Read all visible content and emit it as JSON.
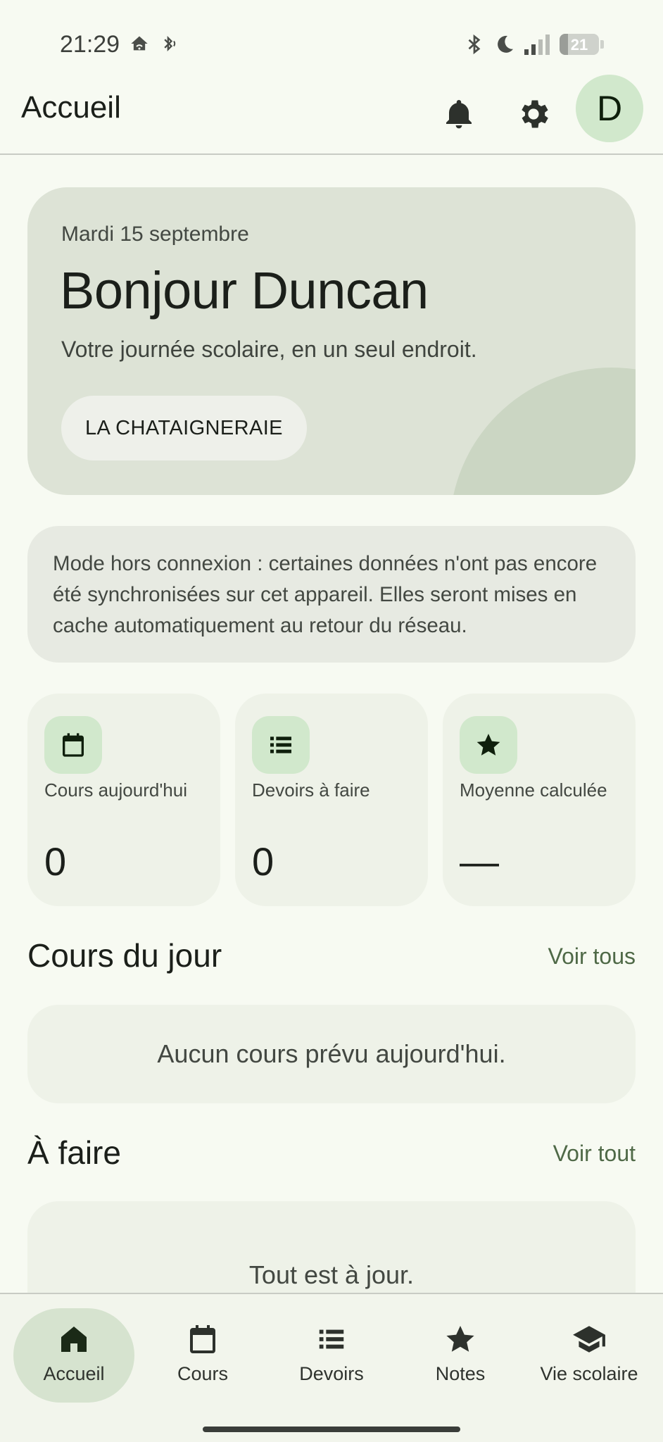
{
  "status_bar": {
    "time": "21:29",
    "battery": "21"
  },
  "app_bar": {
    "title": "Accueil",
    "avatar_initial": "D"
  },
  "greeting": {
    "date": "Mardi 15 septembre",
    "title": "Bonjour Duncan",
    "subtitle": "Votre journée scolaire, en un seul endroit.",
    "school": "LA CHATAIGNERAIE"
  },
  "offline_notice": "Mode hors connexion : certaines données n'ont pas encore été synchronisées sur cet appareil. Elles seront mises en cache automatiquement au retour du réseau.",
  "stats": [
    {
      "label": "Cours aujourd'hui",
      "value": "0",
      "icon": "calendar-icon"
    },
    {
      "label": "Devoirs à faire",
      "value": "0",
      "icon": "list-icon"
    },
    {
      "label": "Moyenne calculée",
      "value": "—",
      "icon": "star-icon"
    }
  ],
  "courses_section": {
    "title": "Cours du jour",
    "link": "Voir tous",
    "empty": "Aucun cours prévu aujourd'hui."
  },
  "todo_section": {
    "title": "À faire",
    "link": "Voir tout",
    "empty": "Tout est à jour."
  },
  "nav": [
    {
      "label": "Accueil",
      "icon": "home-icon",
      "active": true
    },
    {
      "label": "Cours",
      "icon": "calendar-icon"
    },
    {
      "label": "Devoirs",
      "icon": "list-icon"
    },
    {
      "label": "Notes",
      "icon": "star-icon"
    },
    {
      "label": "Vie scolaire",
      "icon": "graduation-cap-icon"
    }
  ],
  "colors": {
    "background": "#f7faf2",
    "accent_container": "#d1e8cc",
    "link": "#4f6947"
  }
}
